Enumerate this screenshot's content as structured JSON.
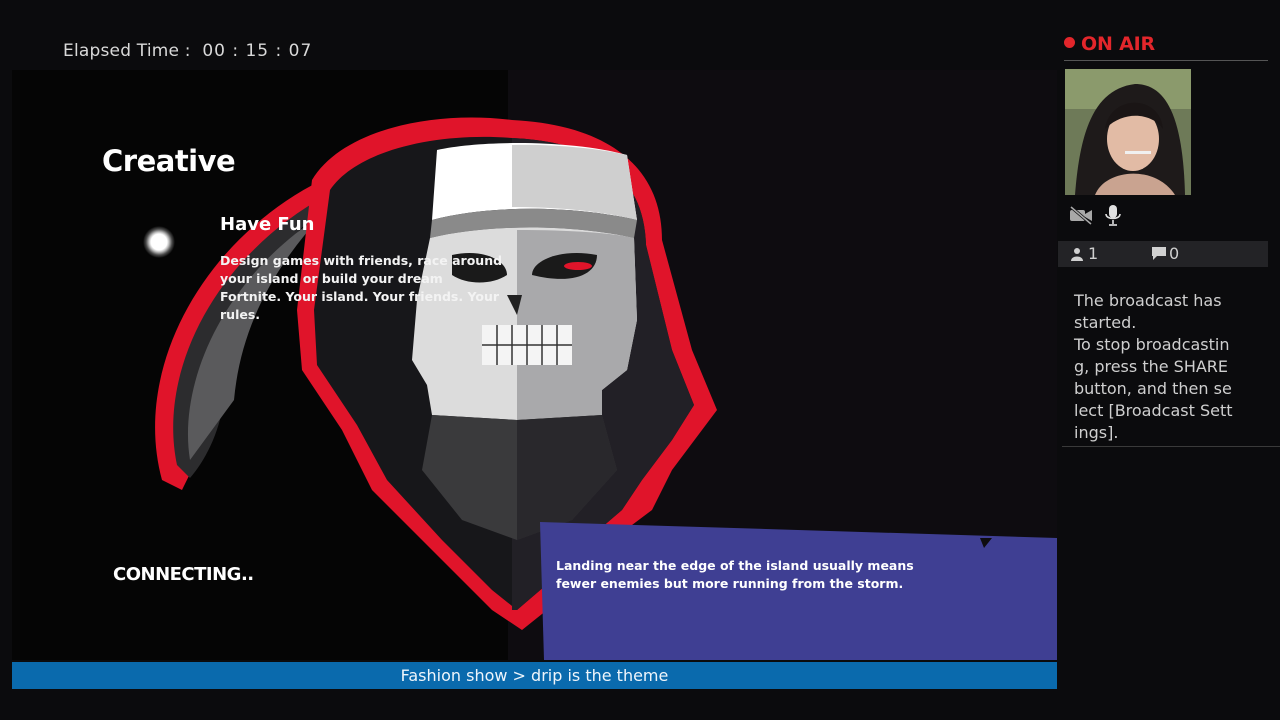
{
  "header": {
    "elapsed_label": "Elapsed Time :",
    "elapsed_time": "00 : 15 : 07"
  },
  "game": {
    "title": "Creative",
    "mode_name": "Have Fun",
    "mode_description": "Design games with friends, race around your island or build your dream Fortnite. Your island. Your friends. Your rules.",
    "status": "CONNECTING..",
    "tip": "Landing near the edge of the island usually means fewer enemies but more running from the storm.",
    "tip_box_color": "#3f3f93",
    "accent_color": "#e0142a"
  },
  "ticker": {
    "text": "Fashion show > drip is the theme",
    "color": "#0a6aad"
  },
  "broadcast": {
    "status": "ON AIR",
    "status_color": "#e3262b",
    "camera_icon": "camera-off-icon",
    "mic_icon": "microphone-icon",
    "viewers": "1",
    "comments": "0",
    "message": "The broadcast has started.\nTo stop broadcasting, press the SHARE button, and then select [Broadcast Settings]."
  }
}
